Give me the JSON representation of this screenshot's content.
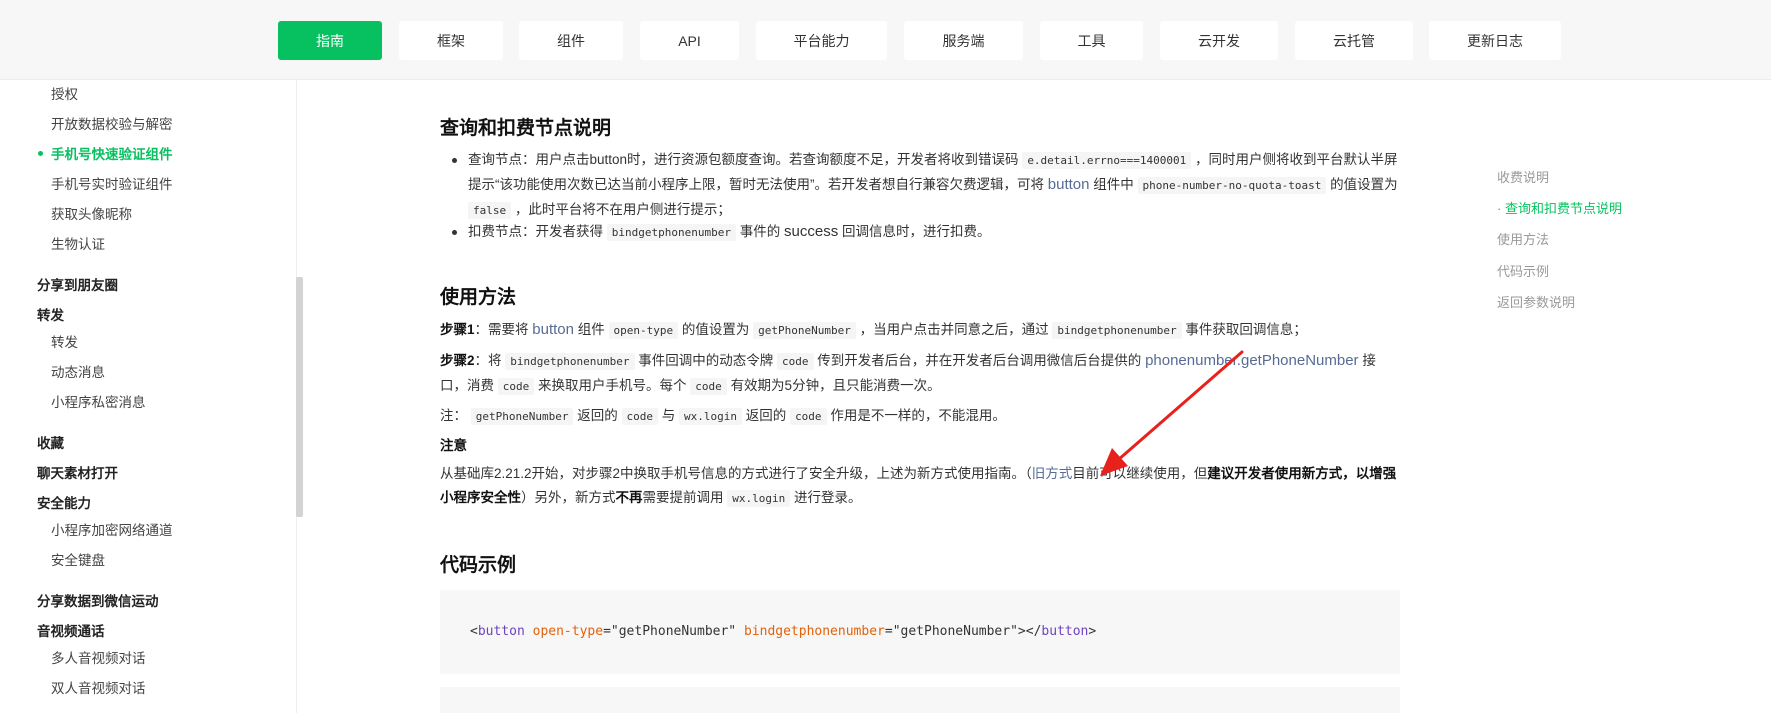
{
  "nav": {
    "tabs": [
      "指南",
      "框架",
      "组件",
      "API",
      "平台能力",
      "服务端",
      "工具",
      "云开发",
      "云托管",
      "更新日志"
    ],
    "active_index": 0
  },
  "sidebar": {
    "items": [
      {
        "label": "授权",
        "kind": "sub"
      },
      {
        "label": "开放数据校验与解密",
        "kind": "sub"
      },
      {
        "label": "手机号快速验证组件",
        "kind": "sub",
        "active": true
      },
      {
        "label": "手机号实时验证组件",
        "kind": "sub"
      },
      {
        "label": "获取头像昵称",
        "kind": "sub"
      },
      {
        "label": "生物认证",
        "kind": "sub"
      },
      {
        "label": "分享到朋友圈",
        "kind": "group"
      },
      {
        "label": "转发",
        "kind": "group"
      },
      {
        "label": "转发",
        "kind": "sub"
      },
      {
        "label": "动态消息",
        "kind": "sub"
      },
      {
        "label": "小程序私密消息",
        "kind": "sub"
      },
      {
        "label": "收藏",
        "kind": "group"
      },
      {
        "label": "聊天素材打开",
        "kind": "group"
      },
      {
        "label": "安全能力",
        "kind": "group"
      },
      {
        "label": "小程序加密网络通道",
        "kind": "sub"
      },
      {
        "label": "安全键盘",
        "kind": "sub"
      },
      {
        "label": "分享数据到微信运动",
        "kind": "group"
      },
      {
        "label": "音视频通话",
        "kind": "group"
      },
      {
        "label": "多人音视频对话",
        "kind": "sub"
      },
      {
        "label": "双人音视频对话",
        "kind": "sub"
      }
    ]
  },
  "main": {
    "h_query": "查询和扣费节点说明",
    "b1_prefix": "查询节点：用户点击button时，进行资源包额度查询。若查询额度不足，开发者将收到错误码",
    "b1_code1": "e.detail.errno===1400001",
    "b1_mid": "，同时用户侧将收到平台默认半屏提示“该功能使用次数已达当前小程序上限，暂时无法使用”。若开发者想自行兼容欠费逻辑，可将",
    "b1_link": "button",
    "b1_mid2": "组件中",
    "b1_code2": "phone-number-no-quota-toast",
    "b1_mid3": "的值设置为",
    "b1_code3": "false",
    "b1_end": "，此时平台将不在用户侧进行提示；",
    "b2_prefix": "扣费节点：开发者获得",
    "b2_code": "bindgetphonenumber",
    "b2_mid": "事件的",
    "b2_success": "success",
    "b2_end": "回调信息时，进行扣费。",
    "h_usage": "使用方法",
    "s1_label": "步骤1",
    "s1_a": "：需要将",
    "s1_link": "button",
    "s1_b": "组件",
    "s1_code1": "open-type",
    "s1_c": "的值设置为",
    "s1_code2": "getPhoneNumber",
    "s1_d": "，当用户点击并同意之后，通过",
    "s1_code3": "bindgetphonenumber",
    "s1_e": "事件获取回调信息；",
    "s2_label": "步骤2",
    "s2_a": "：将",
    "s2_code1": "bindgetphonenumber",
    "s2_b": "事件回调中的动态令牌",
    "s2_code2": "code",
    "s2_c": "传到开发者后台，并在开发者后台调用微信后台提供的",
    "s2_link": "phonenumber.getPhoneNumber",
    "s2_d": "接口，消费",
    "s2_code3": "code",
    "s2_e": "来换取用户手机号。每个",
    "s2_code4": "code",
    "s2_f": "有效期为5分钟，且只能消费一次。",
    "note_a": "注：",
    "note_code1": "getPhoneNumber",
    "note_b": "返回的",
    "note_code2": "code",
    "note_c": "与",
    "note_code3": "wx.login",
    "note_d": "返回的",
    "note_code4": "code",
    "note_e": "作用是不一样的，不能混用。",
    "attention": "注意",
    "att_a": "从基础库2.21.2开始，对步骤2中换取手机号信息的方式进行了安全升级，上述为新方式使用指南。（",
    "att_link": "旧方式",
    "att_b": "目前可以继续使用，但",
    "att_bold1": "建议开发者使用新方式，以增强小程序安全性",
    "att_c": "）另外，新方式",
    "att_bold2": "不再",
    "att_d": "需要提前调用",
    "att_code": "wx.login",
    "att_e": "进行登录。",
    "h_code": "代码示例",
    "code": {
      "lt": "<",
      "tag": "button",
      "attr1": "open-type",
      "eq1": "=",
      "val1": "\"getPhoneNumber\"",
      "attr2": "bindgetphonenumber",
      "eq2": "=",
      "val2": "\"getPhoneNumber\"",
      "close_open": "></",
      "tag2": "button",
      "gt": ">"
    }
  },
  "toc": {
    "items": [
      "收费说明",
      "· 查询和扣费节点说明",
      "使用方法",
      "代码示例",
      "返回参数说明"
    ],
    "active_index": 1
  },
  "colors": {
    "accent": "#07c160",
    "link": "#576b95",
    "arrow": "#e8211d"
  }
}
